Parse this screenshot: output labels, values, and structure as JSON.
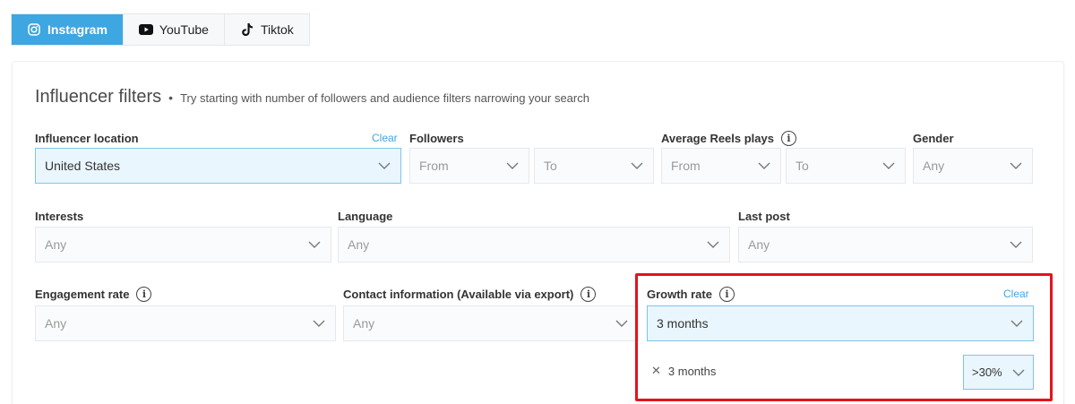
{
  "tabs": [
    {
      "label": "Instagram",
      "icon": "instagram-icon",
      "active": true
    },
    {
      "label": "YouTube",
      "icon": "youtube-icon",
      "active": false
    },
    {
      "label": "Tiktok",
      "icon": "tiktok-icon",
      "active": false
    }
  ],
  "heading": {
    "title": "Influencer filters",
    "separator": "•",
    "hint": "Try starting with number of followers and audience filters narrowing your search"
  },
  "filters": {
    "location": {
      "label": "Influencer location",
      "clear": "Clear",
      "value": "United States"
    },
    "followers": {
      "label": "Followers",
      "from": "From",
      "to": "To"
    },
    "reels": {
      "label": "Average Reels plays",
      "from": "From",
      "to": "To"
    },
    "gender": {
      "label": "Gender",
      "value": "Any"
    },
    "interests": {
      "label": "Interests",
      "value": "Any"
    },
    "language": {
      "label": "Language",
      "value": "Any"
    },
    "last_post": {
      "label": "Last post",
      "value": "Any"
    },
    "engagement": {
      "label": "Engagement rate",
      "value": "Any"
    },
    "contact": {
      "label": "Contact information (Available via export)",
      "value": "Any"
    },
    "growth": {
      "label": "Growth rate",
      "clear": "Clear",
      "value": "3 months",
      "chip": "3 months",
      "threshold": ">30%"
    }
  },
  "colors": {
    "accent": "#3ea6e0",
    "highlight": "#e3141b",
    "selected_bg": "#eaf6fd"
  }
}
